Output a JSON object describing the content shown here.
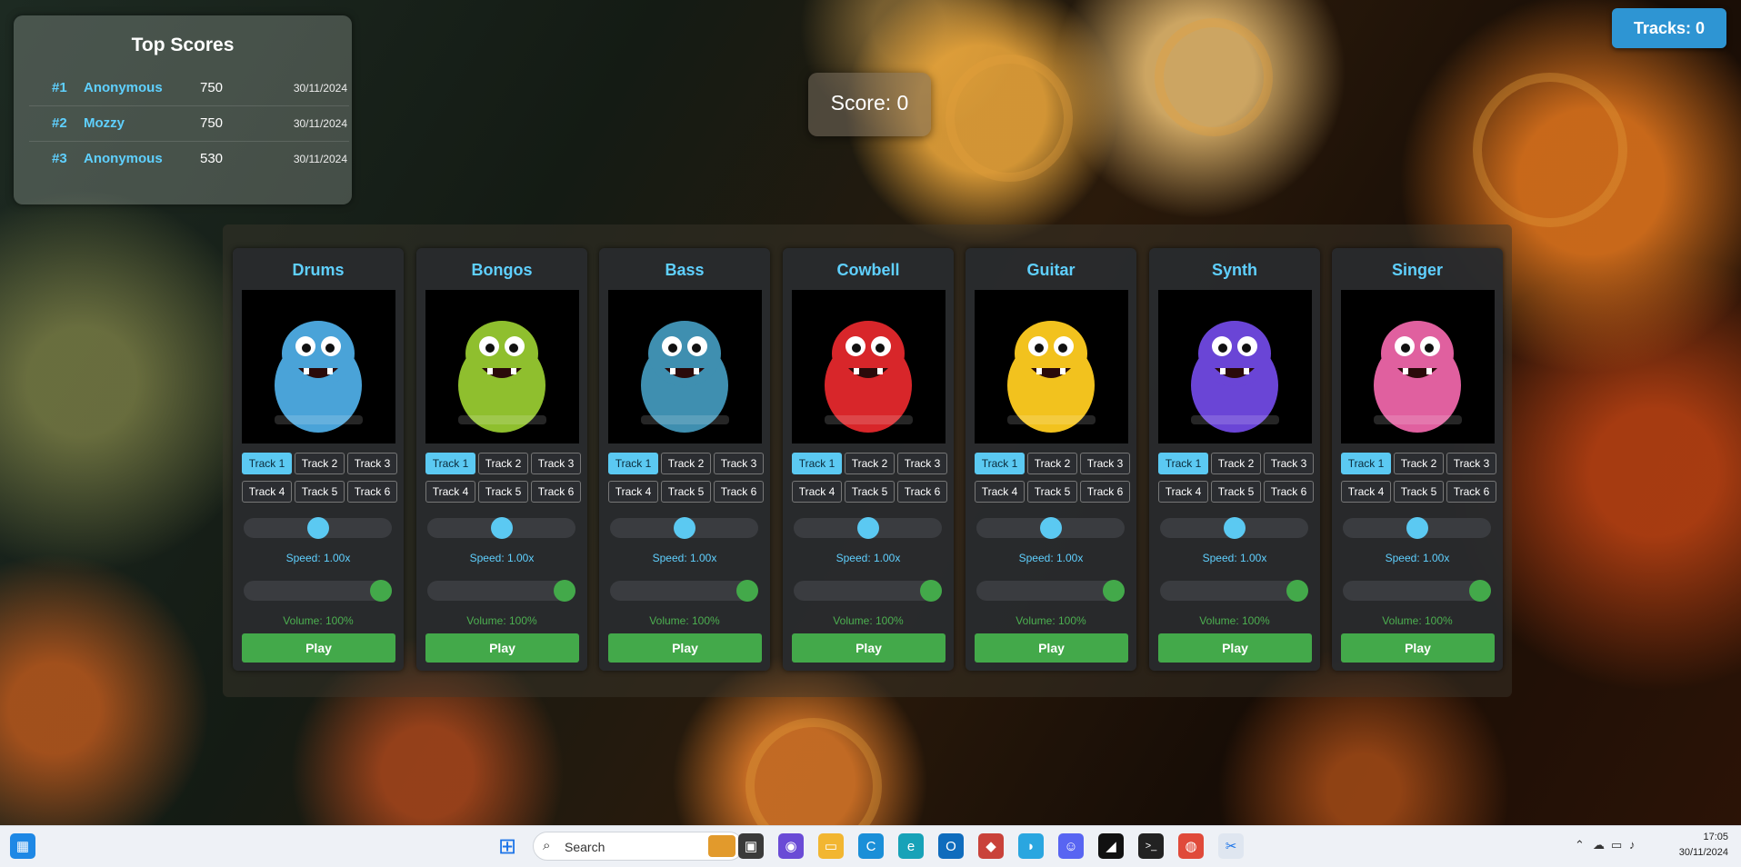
{
  "top_scores": {
    "title": "Top Scores",
    "rows": [
      {
        "rank": "#1",
        "name": "Anonymous",
        "score": "750",
        "date": "30/11/2024"
      },
      {
        "rank": "#2",
        "name": "Mozzy",
        "score": "750",
        "date": "30/11/2024"
      },
      {
        "rank": "#3",
        "name": "Anonymous",
        "score": "530",
        "date": "30/11/2024"
      }
    ]
  },
  "score_label": "Score: 0",
  "tracks_label": "Tracks: 0",
  "instruments": [
    {
      "name": "Drums",
      "color": "#4aa3d8",
      "speed": 0.5,
      "volume": 1.0
    },
    {
      "name": "Bongos",
      "color": "#8fbf2e",
      "speed": 0.5,
      "volume": 1.0
    },
    {
      "name": "Bass",
      "color": "#3f8fb0",
      "speed": 0.5,
      "volume": 1.0
    },
    {
      "name": "Cowbell",
      "color": "#d8262a",
      "speed": 0.5,
      "volume": 1.0
    },
    {
      "name": "Guitar",
      "color": "#f2c21e",
      "speed": 0.5,
      "volume": 1.0
    },
    {
      "name": "Synth",
      "color": "#6a45d6",
      "speed": 0.5,
      "volume": 1.0
    },
    {
      "name": "Singer",
      "color": "#e0609f",
      "speed": 0.5,
      "volume": 1.0
    }
  ],
  "track_labels": [
    "Track 1",
    "Track 2",
    "Track 3",
    "Track 4",
    "Track 5",
    "Track 6"
  ],
  "speed_text": "Speed: 1.00x",
  "volume_text": "Volume: 100%",
  "play_label": "Play",
  "colors": {
    "accent": "#5bc9f2",
    "play": "#43a94a",
    "speed_knob": "#5bc9f2",
    "volume_knob": "#43a94a"
  },
  "taskbar": {
    "search_placeholder": "Search",
    "time": "17:05",
    "date": "30/11/2024"
  }
}
